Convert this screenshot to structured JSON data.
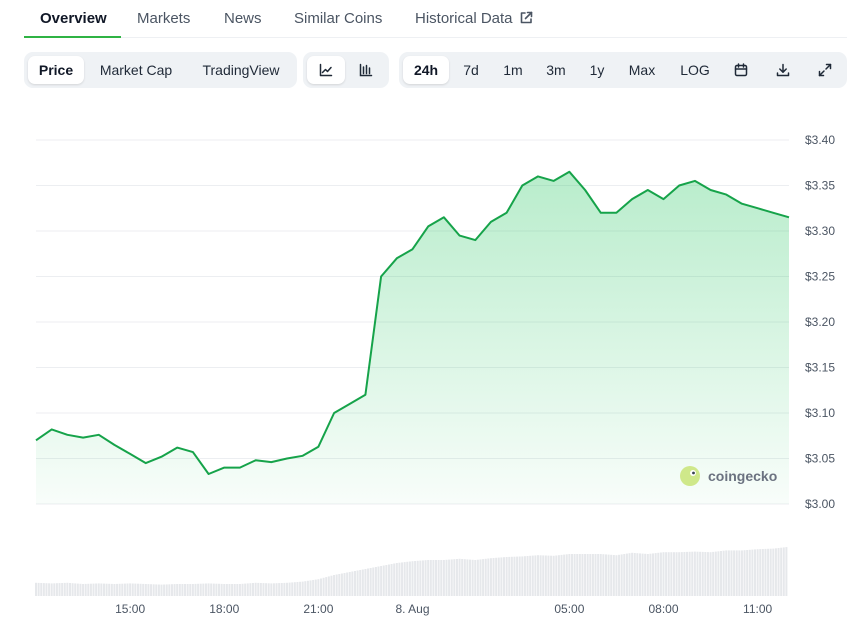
{
  "nav": {
    "tabs": [
      {
        "label": "Overview",
        "active": true
      },
      {
        "label": "Markets",
        "active": false
      },
      {
        "label": "News",
        "active": false
      },
      {
        "label": "Similar Coins",
        "active": false
      },
      {
        "label": "Historical Data",
        "active": false,
        "icon": "external-link-icon"
      }
    ]
  },
  "toolbar": {
    "metric_tabs": [
      {
        "label": "Price",
        "selected": true
      },
      {
        "label": "Market Cap",
        "selected": false
      },
      {
        "label": "TradingView",
        "selected": false
      }
    ],
    "chart_style": [
      {
        "icon": "line-chart-icon",
        "selected": true
      },
      {
        "icon": "candlestick-chart-icon",
        "selected": false
      }
    ],
    "ranges": [
      {
        "label": "24h",
        "selected": true
      },
      {
        "label": "7d",
        "selected": false
      },
      {
        "label": "1m",
        "selected": false
      },
      {
        "label": "3m",
        "selected": false
      },
      {
        "label": "1y",
        "selected": false
      },
      {
        "label": "Max",
        "selected": false
      },
      {
        "label": "LOG",
        "selected": false
      }
    ],
    "actions": [
      {
        "icon": "calendar-icon"
      },
      {
        "icon": "download-icon"
      },
      {
        "icon": "fullscreen-icon"
      }
    ]
  },
  "watermark": "coingecko",
  "colors": {
    "accent": "#2fb344",
    "line": "#16a34a",
    "volume": "#e5e7eb"
  },
  "chart_data": {
    "type": "area",
    "grid": true,
    "ylim": [
      3.0,
      3.4
    ],
    "y_ticks": [
      "$3.40",
      "$3.35",
      "$3.30",
      "$3.25",
      "$3.20",
      "$3.15",
      "$3.10",
      "$3.05",
      "$3.00"
    ],
    "x_ticks": [
      "15:00",
      "18:00",
      "21:00",
      "8. Aug",
      "05:00",
      "08:00",
      "11:00"
    ],
    "x_tick_hours": [
      15,
      18,
      21,
      24,
      29,
      32,
      35
    ],
    "x_hours": [
      12.0,
      12.5,
      13.0,
      13.5,
      14.0,
      14.5,
      15.0,
      15.5,
      16.0,
      16.5,
      17.0,
      17.5,
      18.0,
      18.5,
      19.0,
      19.5,
      20.0,
      20.5,
      21.0,
      21.5,
      22.0,
      22.5,
      23.0,
      23.5,
      24.0,
      24.5,
      25.0,
      25.5,
      26.0,
      26.5,
      27.0,
      27.5,
      28.0,
      28.5,
      29.0,
      29.5,
      30.0,
      30.5,
      31.0,
      31.5,
      32.0,
      32.5,
      33.0,
      33.5,
      34.0,
      34.5,
      35.0,
      35.5,
      36.0
    ],
    "y": [
      3.07,
      3.082,
      3.076,
      3.073,
      3.076,
      3.065,
      3.055,
      3.045,
      3.052,
      3.062,
      3.057,
      3.033,
      3.04,
      3.04,
      3.048,
      3.046,
      3.05,
      3.053,
      3.063,
      3.1,
      3.11,
      3.12,
      3.25,
      3.27,
      3.28,
      3.305,
      3.315,
      3.295,
      3.29,
      3.31,
      3.32,
      3.35,
      3.36,
      3.355,
      3.365,
      3.345,
      3.32,
      3.32,
      3.335,
      3.345,
      3.335,
      3.35,
      3.355,
      3.345,
      3.34,
      3.33,
      3.325,
      3.32,
      3.315
    ],
    "volume": [
      0.22,
      0.21,
      0.22,
      0.2,
      0.21,
      0.2,
      0.21,
      0.2,
      0.19,
      0.2,
      0.2,
      0.21,
      0.2,
      0.2,
      0.22,
      0.21,
      0.22,
      0.24,
      0.28,
      0.35,
      0.4,
      0.45,
      0.5,
      0.55,
      0.58,
      0.6,
      0.6,
      0.62,
      0.6,
      0.63,
      0.65,
      0.66,
      0.68,
      0.67,
      0.7,
      0.7,
      0.7,
      0.68,
      0.72,
      0.7,
      0.73,
      0.73,
      0.74,
      0.73,
      0.76,
      0.76,
      0.78,
      0.79,
      0.82
    ]
  }
}
